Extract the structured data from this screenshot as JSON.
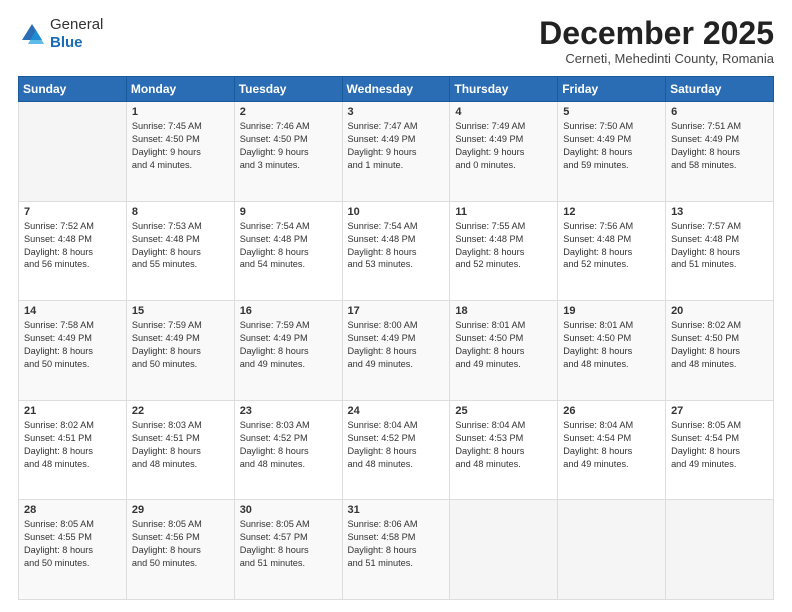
{
  "logo": {
    "general": "General",
    "blue": "Blue"
  },
  "header": {
    "month": "December 2025",
    "location": "Cerneti, Mehedinti County, Romania"
  },
  "weekdays": [
    "Sunday",
    "Monday",
    "Tuesday",
    "Wednesday",
    "Thursday",
    "Friday",
    "Saturday"
  ],
  "weeks": [
    [
      {
        "day": "",
        "content": ""
      },
      {
        "day": "1",
        "content": "Sunrise: 7:45 AM\nSunset: 4:50 PM\nDaylight: 9 hours\nand 4 minutes."
      },
      {
        "day": "2",
        "content": "Sunrise: 7:46 AM\nSunset: 4:50 PM\nDaylight: 9 hours\nand 3 minutes."
      },
      {
        "day": "3",
        "content": "Sunrise: 7:47 AM\nSunset: 4:49 PM\nDaylight: 9 hours\nand 1 minute."
      },
      {
        "day": "4",
        "content": "Sunrise: 7:49 AM\nSunset: 4:49 PM\nDaylight: 9 hours\nand 0 minutes."
      },
      {
        "day": "5",
        "content": "Sunrise: 7:50 AM\nSunset: 4:49 PM\nDaylight: 8 hours\nand 59 minutes."
      },
      {
        "day": "6",
        "content": "Sunrise: 7:51 AM\nSunset: 4:49 PM\nDaylight: 8 hours\nand 58 minutes."
      }
    ],
    [
      {
        "day": "7",
        "content": "Sunrise: 7:52 AM\nSunset: 4:48 PM\nDaylight: 8 hours\nand 56 minutes."
      },
      {
        "day": "8",
        "content": "Sunrise: 7:53 AM\nSunset: 4:48 PM\nDaylight: 8 hours\nand 55 minutes."
      },
      {
        "day": "9",
        "content": "Sunrise: 7:54 AM\nSunset: 4:48 PM\nDaylight: 8 hours\nand 54 minutes."
      },
      {
        "day": "10",
        "content": "Sunrise: 7:54 AM\nSunset: 4:48 PM\nDaylight: 8 hours\nand 53 minutes."
      },
      {
        "day": "11",
        "content": "Sunrise: 7:55 AM\nSunset: 4:48 PM\nDaylight: 8 hours\nand 52 minutes."
      },
      {
        "day": "12",
        "content": "Sunrise: 7:56 AM\nSunset: 4:48 PM\nDaylight: 8 hours\nand 52 minutes."
      },
      {
        "day": "13",
        "content": "Sunrise: 7:57 AM\nSunset: 4:48 PM\nDaylight: 8 hours\nand 51 minutes."
      }
    ],
    [
      {
        "day": "14",
        "content": "Sunrise: 7:58 AM\nSunset: 4:49 PM\nDaylight: 8 hours\nand 50 minutes."
      },
      {
        "day": "15",
        "content": "Sunrise: 7:59 AM\nSunset: 4:49 PM\nDaylight: 8 hours\nand 50 minutes."
      },
      {
        "day": "16",
        "content": "Sunrise: 7:59 AM\nSunset: 4:49 PM\nDaylight: 8 hours\nand 49 minutes."
      },
      {
        "day": "17",
        "content": "Sunrise: 8:00 AM\nSunset: 4:49 PM\nDaylight: 8 hours\nand 49 minutes."
      },
      {
        "day": "18",
        "content": "Sunrise: 8:01 AM\nSunset: 4:50 PM\nDaylight: 8 hours\nand 49 minutes."
      },
      {
        "day": "19",
        "content": "Sunrise: 8:01 AM\nSunset: 4:50 PM\nDaylight: 8 hours\nand 48 minutes."
      },
      {
        "day": "20",
        "content": "Sunrise: 8:02 AM\nSunset: 4:50 PM\nDaylight: 8 hours\nand 48 minutes."
      }
    ],
    [
      {
        "day": "21",
        "content": "Sunrise: 8:02 AM\nSunset: 4:51 PM\nDaylight: 8 hours\nand 48 minutes."
      },
      {
        "day": "22",
        "content": "Sunrise: 8:03 AM\nSunset: 4:51 PM\nDaylight: 8 hours\nand 48 minutes."
      },
      {
        "day": "23",
        "content": "Sunrise: 8:03 AM\nSunset: 4:52 PM\nDaylight: 8 hours\nand 48 minutes."
      },
      {
        "day": "24",
        "content": "Sunrise: 8:04 AM\nSunset: 4:52 PM\nDaylight: 8 hours\nand 48 minutes."
      },
      {
        "day": "25",
        "content": "Sunrise: 8:04 AM\nSunset: 4:53 PM\nDaylight: 8 hours\nand 48 minutes."
      },
      {
        "day": "26",
        "content": "Sunrise: 8:04 AM\nSunset: 4:54 PM\nDaylight: 8 hours\nand 49 minutes."
      },
      {
        "day": "27",
        "content": "Sunrise: 8:05 AM\nSunset: 4:54 PM\nDaylight: 8 hours\nand 49 minutes."
      }
    ],
    [
      {
        "day": "28",
        "content": "Sunrise: 8:05 AM\nSunset: 4:55 PM\nDaylight: 8 hours\nand 50 minutes."
      },
      {
        "day": "29",
        "content": "Sunrise: 8:05 AM\nSunset: 4:56 PM\nDaylight: 8 hours\nand 50 minutes."
      },
      {
        "day": "30",
        "content": "Sunrise: 8:05 AM\nSunset: 4:57 PM\nDaylight: 8 hours\nand 51 minutes."
      },
      {
        "day": "31",
        "content": "Sunrise: 8:06 AM\nSunset: 4:58 PM\nDaylight: 8 hours\nand 51 minutes."
      },
      {
        "day": "",
        "content": ""
      },
      {
        "day": "",
        "content": ""
      },
      {
        "day": "",
        "content": ""
      }
    ]
  ]
}
